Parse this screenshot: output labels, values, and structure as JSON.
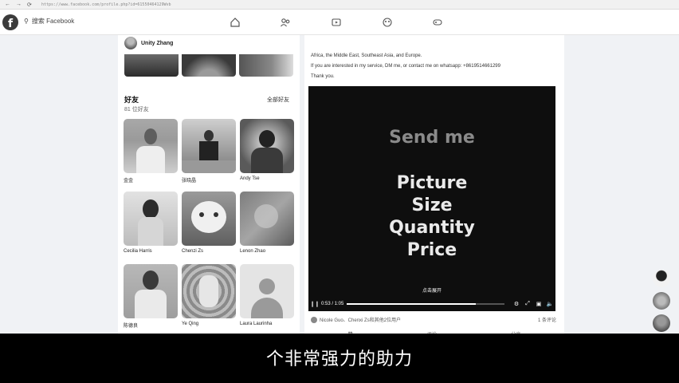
{
  "browser": {
    "back": "←",
    "forward": "→",
    "reload": "⟳",
    "url": "https://www.facebook.com/profile.php?id=61550464129Wvb"
  },
  "fb_nav": {
    "logo": "f",
    "search_placeholder": "搜索 Facebook",
    "icons": [
      "home-icon",
      "friends-icon",
      "video-icon",
      "groups-icon",
      "gaming-icon"
    ]
  },
  "profile": {
    "name": "Unity Zhang"
  },
  "friends": {
    "title": "好友",
    "count": "81 位好友",
    "see_all": "全部好友",
    "items": [
      {
        "name": "金金"
      },
      {
        "name": "张晓晶"
      },
      {
        "name": "Andy Tse"
      },
      {
        "name": "Cecilia Harris"
      },
      {
        "name": "Chenzi Zs"
      },
      {
        "name": "Lenon Zhao"
      },
      {
        "name": "陈德良"
      },
      {
        "name": "Ye Qing"
      },
      {
        "name": "Laura Laurinha"
      }
    ]
  },
  "post": {
    "line1": "Africa, the Middle East, Southeast Asia, and Europe.",
    "line2": "If you are interested in my service, DM me, or contact me on whatsapp: +8619514661299",
    "line3": "Thank you.",
    "video": {
      "headline": "Send me",
      "lines": [
        "Picture",
        "Size",
        "Quantity",
        "Price"
      ],
      "fullscreen_hint": "点击展开",
      "time": "0:53 / 1:05",
      "progress": 0.82
    },
    "reactions": "Nicole Guo、Chenxi Zs和其他2位用户",
    "comments": "1 条评论",
    "actions": [
      "赞",
      "评论",
      "分享"
    ]
  },
  "subtitle": "个非常强力的助力"
}
